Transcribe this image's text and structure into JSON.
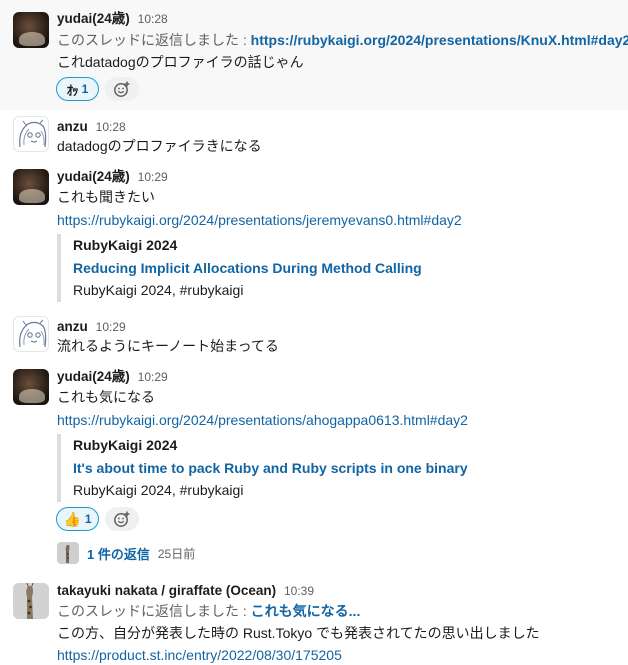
{
  "messages": [
    {
      "author": "yudai(24歳)",
      "time": "10:28",
      "thread_prefix": "このスレッドに返信しました :",
      "thread_link": "https://rubykaigi.org/2024/presentations/KnuX.html#day2",
      "text": "これdatadogのプロファイラの話じゃん",
      "reaction": {
        "emoji": "ｵｯ",
        "count": "1"
      }
    },
    {
      "author": "anzu",
      "time": "10:28",
      "text": "datadogのプロファイラきになる"
    },
    {
      "author": "yudai(24歳)",
      "time": "10:29",
      "text": "これも聞きたい",
      "link": "https://rubykaigi.org/2024/presentations/jeremyevans0.html#day2",
      "unfurl": {
        "site": "RubyKaigi 2024",
        "title": "Reducing Implicit Allocations During Method Calling",
        "description": "RubyKaigi 2024, #rubykaigi"
      }
    },
    {
      "author": "anzu",
      "time": "10:29",
      "text": "流れるようにキーノート始まってる"
    },
    {
      "author": "yudai(24歳)",
      "time": "10:29",
      "text": "これも気になる",
      "link": "https://rubykaigi.org/2024/presentations/ahogappa0613.html#day2",
      "unfurl": {
        "site": "RubyKaigi 2024",
        "title": "It's about time to pack Ruby and Ruby scripts in one binary",
        "description": "RubyKaigi 2024, #rubykaigi"
      },
      "reaction": {
        "emoji": "👍",
        "count": "1"
      },
      "thread": {
        "replies": "1 件の返信",
        "ago": "25日前"
      }
    },
    {
      "author": "takayuki nakata / giraffate (Ocean)",
      "time": "10:39",
      "thread_prefix": "このスレッドに返信しました :",
      "thread_link": "これも気になる...",
      "text": "この方、自分が発表した時の Rust.Tokyo でも発表されてたの思い出しました",
      "link": "https://product.st.inc/entry/2022/08/30/175205"
    }
  ],
  "icons": {
    "add_reaction": "add-reaction-icon",
    "avatar_yudai": "avatar-yudai",
    "avatar_anzu": "avatar-anzu",
    "avatar_takayuki": "avatar-takayuki"
  },
  "colors": {
    "link": "#1264a3",
    "muted": "#616061",
    "reaction_bg": "#e8f5fa",
    "reaction_border": "#1d9bd1",
    "unfurl_bar": "#dddddd",
    "highlight_bg": "#f8f8f8"
  }
}
